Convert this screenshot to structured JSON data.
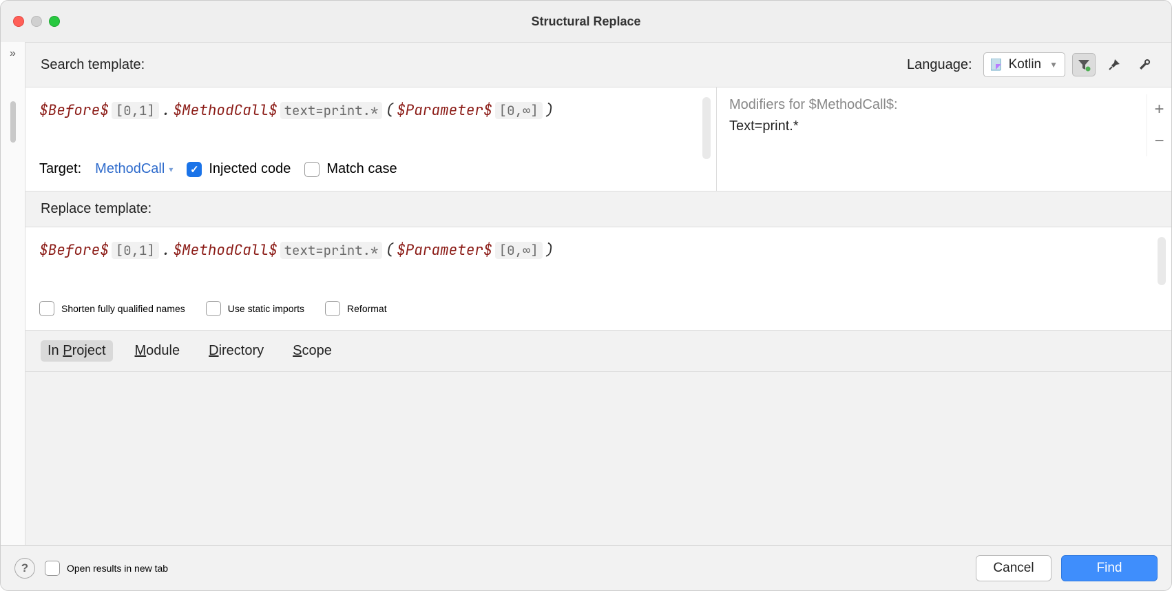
{
  "window": {
    "title": "Structural Replace"
  },
  "search": {
    "label": "Search template:",
    "language_label": "Language:",
    "language_value": "Kotlin",
    "code": {
      "before": "$Before$",
      "before_card": "[0,1]",
      "dot": ".",
      "method": "$MethodCall$",
      "method_filter": "text=print.*",
      "open": "(",
      "param": "$Parameter$",
      "param_card": "[0,∞]",
      "close": ")"
    },
    "target": {
      "label": "Target:",
      "value": "MethodCall"
    },
    "injected_label": "Injected code",
    "matchcase_label": "Match case"
  },
  "modifiers": {
    "title": "Modifiers for $MethodCall$:",
    "body": "Text=print.*"
  },
  "replace": {
    "label": "Replace template:",
    "code": {
      "before": "$Before$",
      "before_card": "[0,1]",
      "dot": ".",
      "method": "$MethodCall$",
      "method_filter": "text=print.*",
      "open": "(",
      "param": "$Parameter$",
      "param_card": "[0,∞]",
      "close": ")"
    },
    "shorten_label": "Shorten fully qualified names",
    "static_label": "Use static imports",
    "reformat_label": "Reformat"
  },
  "scope": {
    "in_project": "In Project",
    "module": "Module",
    "directory": "Directory",
    "scope": "Scope"
  },
  "footer": {
    "open_in_tab": "Open results in new tab",
    "cancel": "Cancel",
    "find": "Find"
  }
}
